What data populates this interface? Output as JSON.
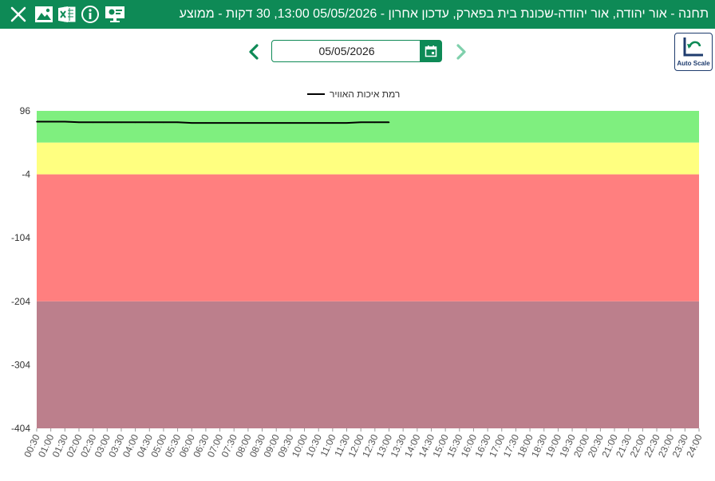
{
  "header": {
    "title": "תחנה - אור יהודה, אור יהודה-שכונת בית בפארק, עדכון אחרון - 05/05/2026 13:00, 30 דקות - ממוצע",
    "icons": [
      "close-icon",
      "image-icon",
      "excel-icon",
      "info-icon",
      "monitor-icon"
    ]
  },
  "toolbar": {
    "date_value": "05/05/2026",
    "autoscale_label": "Auto Scale"
  },
  "colors": {
    "brand": "#0e8a56",
    "band_good": "#7fef7f",
    "band_moderate": "#ffff80",
    "band_bad": "#ff7f7f",
    "band_very_bad": "#bc7f8c",
    "line": "#000000"
  },
  "chart_data": {
    "type": "line",
    "title": "",
    "xlabel": "",
    "ylabel": "",
    "legend": "top-center",
    "ylim": [
      -404,
      96
    ],
    "yticks": [
      "96",
      "-4",
      "-104",
      "-204",
      "-304",
      "-404"
    ],
    "bands": [
      {
        "from": 46,
        "to": 96,
        "color": "#7fef7f"
      },
      {
        "from": -4,
        "to": 46,
        "color": "#ffff80"
      },
      {
        "from": -204,
        "to": -4,
        "color": "#ff7f7f"
      },
      {
        "from": -404,
        "to": -204,
        "color": "#bc7f8c"
      }
    ],
    "x": [
      "00:30",
      "01:00",
      "01:30",
      "02:00",
      "02:30",
      "03:00",
      "03:30",
      "04:00",
      "04:30",
      "05:00",
      "05:30",
      "06:00",
      "06:30",
      "07:00",
      "07:30",
      "08:00",
      "08:30",
      "09:00",
      "09:30",
      "10:00",
      "10:30",
      "11:00",
      "11:30",
      "12:00",
      "12:30",
      "13:00",
      "13:30",
      "14:00",
      "14:30",
      "15:00",
      "15:30",
      "16:00",
      "16:30",
      "17:00",
      "17:30",
      "18:00",
      "18:30",
      "19:00",
      "19:30",
      "20:00",
      "20:30",
      "21:00",
      "21:30",
      "22:00",
      "22:30",
      "23:00",
      "23:30",
      "24:00"
    ],
    "series": [
      {
        "name": "רמת איכות האוויר",
        "color": "#000000",
        "values": [
          79,
          79,
          79,
          78,
          78,
          78,
          78,
          78,
          78,
          78,
          78,
          77,
          77,
          77,
          77,
          77,
          77,
          77,
          77,
          77,
          77,
          77,
          77,
          78,
          78,
          78,
          null,
          null,
          null,
          null,
          null,
          null,
          null,
          null,
          null,
          null,
          null,
          null,
          null,
          null,
          null,
          null,
          null,
          null,
          null,
          null,
          null,
          null
        ]
      }
    ]
  }
}
